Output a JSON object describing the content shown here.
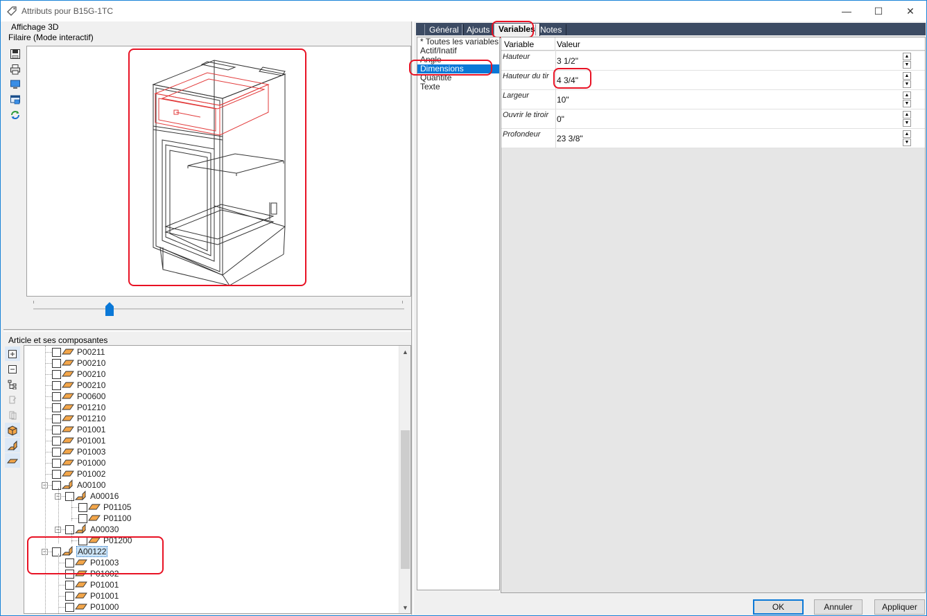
{
  "window": {
    "title": "Attributs pour B15G-1TC",
    "minimize": "—",
    "maximize": "☐",
    "close": "✕"
  },
  "view3d": {
    "heading": "Affichage 3D",
    "mode": "Filaire (Mode interactif)",
    "slider_position": 0.2
  },
  "tree": {
    "heading": "Article et ses composantes",
    "rows": [
      {
        "label": "P00211",
        "level": 0,
        "icon": "panel-icon"
      },
      {
        "label": "P00210",
        "level": 0,
        "icon": "panel-icon"
      },
      {
        "label": "P00210",
        "level": 0,
        "icon": "panel-icon"
      },
      {
        "label": "P00210",
        "level": 0,
        "icon": "panel-icon"
      },
      {
        "label": "P00600",
        "level": 0,
        "icon": "panel-icon"
      },
      {
        "label": "P01210",
        "level": 0,
        "icon": "panel-icon"
      },
      {
        "label": "P01210",
        "level": 0,
        "icon": "panel-icon"
      },
      {
        "label": "P01001",
        "level": 0,
        "icon": "panel-icon"
      },
      {
        "label": "P01001",
        "level": 0,
        "icon": "panel-icon"
      },
      {
        "label": "P01003",
        "level": 0,
        "icon": "panel-icon"
      },
      {
        "label": "P01000",
        "level": 0,
        "icon": "panel-icon"
      },
      {
        "label": "P01002",
        "level": 0,
        "icon": "panel-icon"
      },
      {
        "label": "A00100",
        "level": 0,
        "icon": "assembly-icon"
      },
      {
        "label": "A00016",
        "level": 1,
        "icon": "assembly-icon"
      },
      {
        "label": "P01105",
        "level": 2,
        "icon": "panel-icon"
      },
      {
        "label": "P01100",
        "level": 2,
        "icon": "panel-icon"
      },
      {
        "label": "A00030",
        "level": 1,
        "icon": "assembly-icon"
      },
      {
        "label": "P01200",
        "level": 2,
        "icon": "panel-icon"
      },
      {
        "label": "A00122",
        "level": 0,
        "icon": "assembly-icon",
        "selected": true
      },
      {
        "label": "P01003",
        "level": 1,
        "icon": "panel-icon"
      },
      {
        "label": "P01002",
        "level": 1,
        "icon": "panel-icon"
      },
      {
        "label": "P01001",
        "level": 1,
        "icon": "panel-icon"
      },
      {
        "label": "P01001",
        "level": 1,
        "icon": "panel-icon"
      },
      {
        "label": "P01000",
        "level": 1,
        "icon": "panel-icon"
      }
    ]
  },
  "tabs": [
    {
      "label": "Général",
      "active": false
    },
    {
      "label": "Ajouts",
      "active": false
    },
    {
      "label": "Variables",
      "active": true
    },
    {
      "label": "Notes",
      "active": false
    }
  ],
  "categories": [
    {
      "label": "* Toutes les variables",
      "selected": false
    },
    {
      "label": "Actif/Inatif",
      "selected": false
    },
    {
      "label": "Angle",
      "selected": false
    },
    {
      "label": "Dimensions",
      "selected": true
    },
    {
      "label": "Quantité",
      "selected": false
    },
    {
      "label": "Texte",
      "selected": false
    }
  ],
  "grid": {
    "col_variable": "Variable",
    "col_value": "Valeur",
    "rows": [
      {
        "variable": "Hauteur",
        "value": "3 1/2\""
      },
      {
        "variable": "Hauteur du tir",
        "value": "4 3/4\""
      },
      {
        "variable": "Largeur",
        "value": "10\""
      },
      {
        "variable": "Ouvrir le tiroir",
        "value": "0\""
      },
      {
        "variable": "Profondeur",
        "value": "23 3/8\""
      }
    ]
  },
  "buttons": {
    "ok": "OK",
    "cancel": "Annuler",
    "apply": "Appliquer"
  },
  "colors": {
    "highlight": "#e81123",
    "accent": "#0a78d7",
    "tab_strip": "#3c4b63"
  }
}
